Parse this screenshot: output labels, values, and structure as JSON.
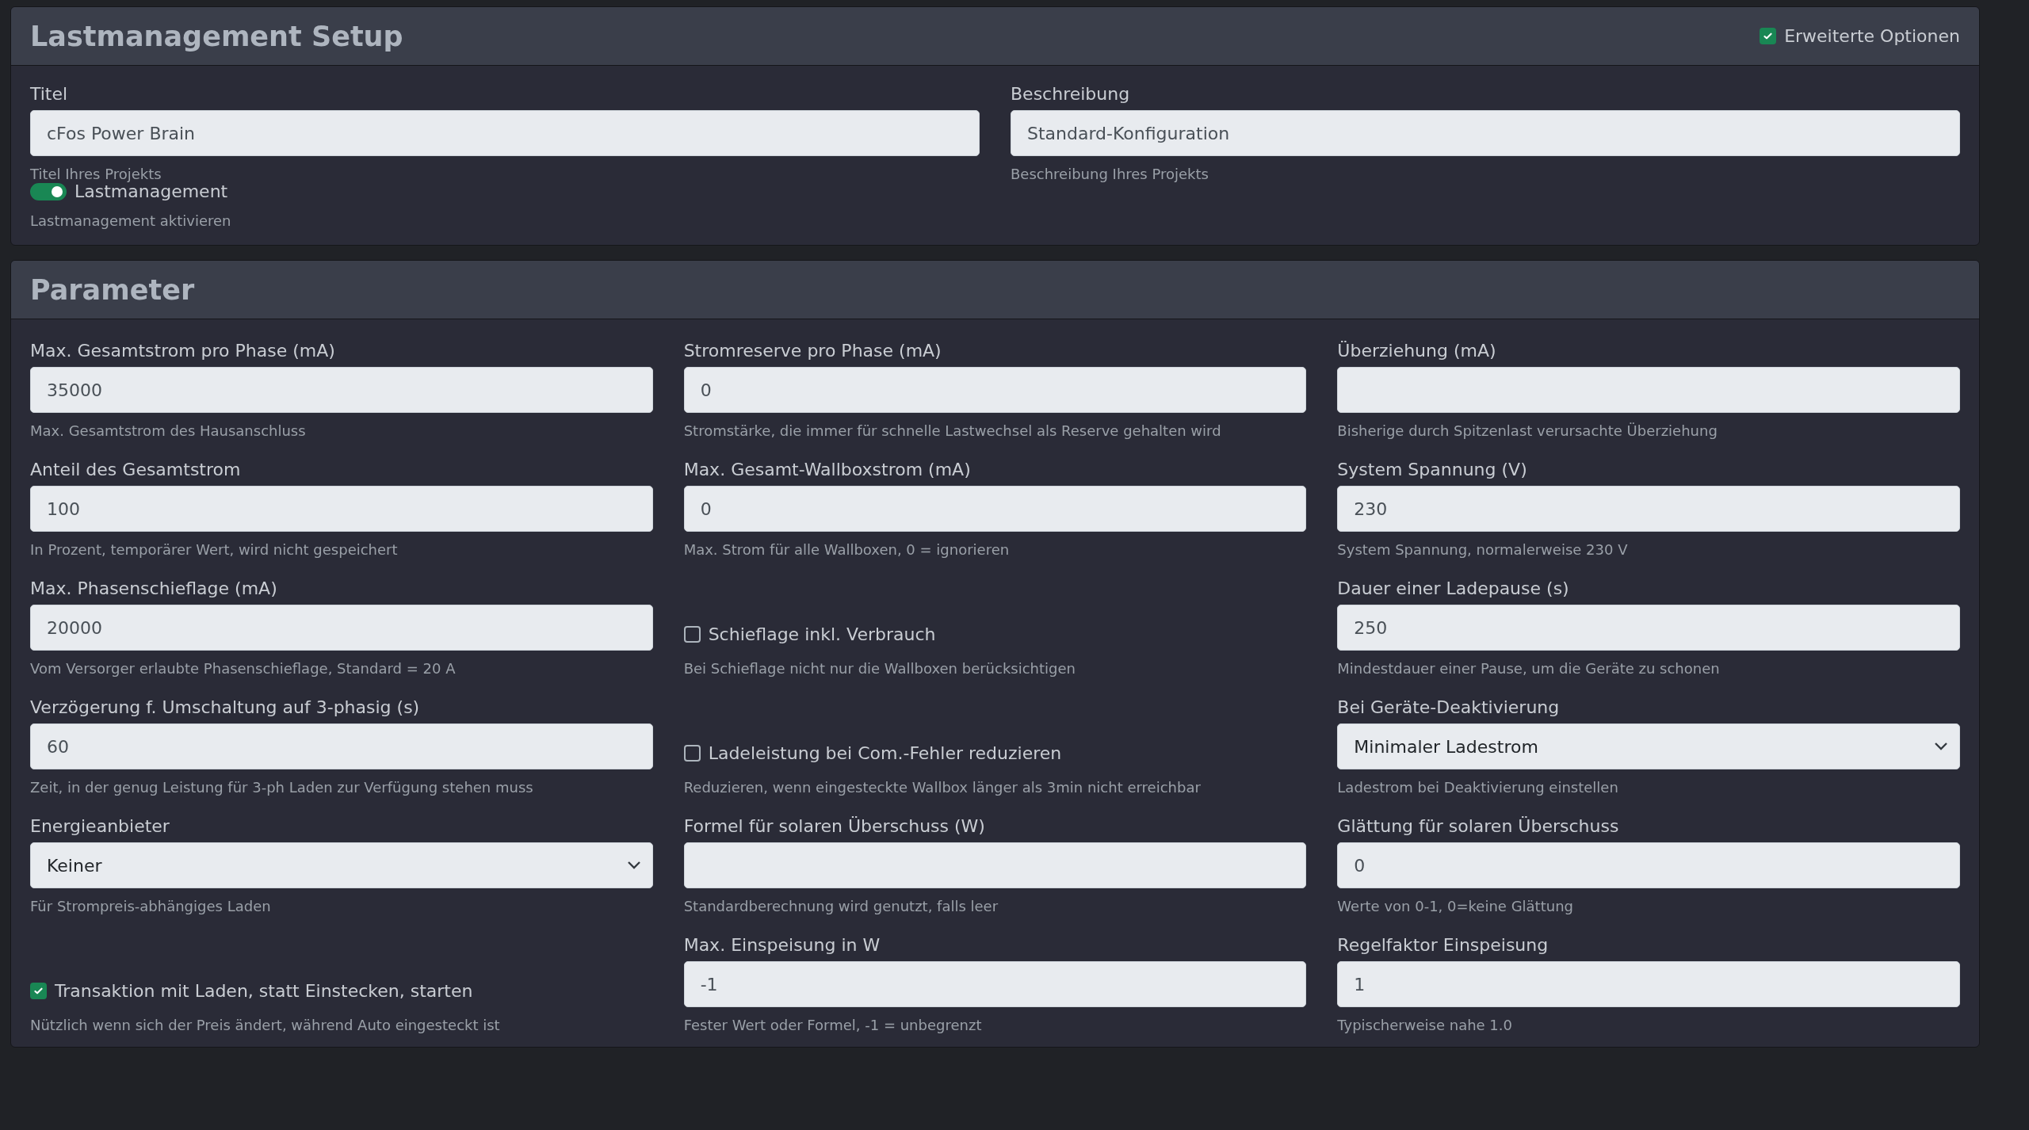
{
  "setup": {
    "title": "Lastmanagement Setup",
    "advanced": {
      "label": "Erweiterte Optionen",
      "checked": true
    },
    "fields": [
      {
        "label": "Titel",
        "value": "cFos Power Brain",
        "hint": "Titel Ihres Projekts"
      },
      {
        "label": "Beschreibung",
        "value": "Standard-Konfiguration",
        "hint": "Beschreibung Ihres Projekts"
      }
    ],
    "toggle": {
      "label": "Lastmanagement",
      "on": true,
      "hint": "Lastmanagement aktivieren"
    }
  },
  "parameter": {
    "title": "Parameter",
    "items": [
      {
        "kind": "input",
        "label": "Max. Gesamtstrom pro Phase (mA)",
        "value": "35000",
        "hint": "Max. Gesamtstrom des Hausanschluss"
      },
      {
        "kind": "input",
        "label": "Stromreserve pro Phase (mA)",
        "value": "0",
        "hint": "Stromstärke, die immer für schnelle Lastwechsel als Reserve gehalten wird"
      },
      {
        "kind": "input",
        "label": "Überziehung (mA)",
        "hint": "Bisherige durch Spitzenlast verursachte Überziehung"
      },
      {
        "kind": "input",
        "label": "Anteil des Gesamtstrom",
        "value": "100",
        "hint": "In Prozent, temporärer Wert, wird nicht gespeichert"
      },
      {
        "kind": "input",
        "label": "Max. Gesamt-Wallboxstrom (mA)",
        "value": "0",
        "hint": "Max. Strom für alle Wallboxen, 0 = ignorieren"
      },
      {
        "kind": "input",
        "label": "System Spannung (V)",
        "value": "230",
        "hint": "System Spannung, normalerweise 230 V"
      },
      {
        "kind": "input",
        "label": "Max. Phasenschieflage (mA)",
        "value": "20000",
        "hint": "Vom Versorger erlaubte Phasenschieflage, Standard = 20 A"
      },
      {
        "kind": "checkbox",
        "label": "Schieflage inkl. Verbrauch",
        "checked": false,
        "hint": "Bei Schieflage nicht nur die Wallboxen berücksichtigen"
      },
      {
        "kind": "input",
        "label": "Dauer einer Ladepause (s)",
        "value": "250",
        "hint": "Mindestdauer einer Pause, um die Geräte zu schonen"
      },
      {
        "kind": "input",
        "label": "Verzögerung f. Umschaltung auf 3-phasig (s)",
        "value": "60",
        "hint": "Zeit, in der genug Leistung für 3-ph Laden zur Verfügung stehen muss"
      },
      {
        "kind": "checkbox",
        "label": "Ladeleistung bei Com.-Fehler reduzieren",
        "checked": false,
        "hint": "Reduzieren, wenn eingesteckte Wallbox länger als 3min nicht erreichbar"
      },
      {
        "kind": "select",
        "label": "Bei Geräte-Deaktivierung",
        "value": "Minimaler Ladestrom",
        "hint": "Ladestrom bei Deaktivierung einstellen"
      },
      {
        "kind": "select",
        "label": "Energieanbieter",
        "value": "Keiner",
        "hint": "Für Strompreis-abhängiges Laden"
      },
      {
        "kind": "input",
        "label": "Formel für solaren Überschuss (W)",
        "hint": "Standardberechnung wird genutzt, falls leer"
      },
      {
        "kind": "input",
        "label": "Glättung für solaren Überschuss",
        "value": "0",
        "hint": "Werte von 0-1, 0=keine Glättung"
      },
      {
        "kind": "checkbox",
        "label": "Transaktion mit Laden, statt Einstecken, starten",
        "checked": true,
        "hint": "Nützlich wenn sich der Preis ändert, während Auto eingesteckt ist"
      },
      {
        "kind": "input",
        "label": "Max. Einspeisung in W",
        "value": "-1",
        "hint": "Fester Wert oder Formel, -1 = unbegrenzt"
      },
      {
        "kind": "input",
        "label": "Regelfaktor Einspeisung",
        "value": "1",
        "hint": "Typischerweise nahe 1.0"
      }
    ]
  }
}
